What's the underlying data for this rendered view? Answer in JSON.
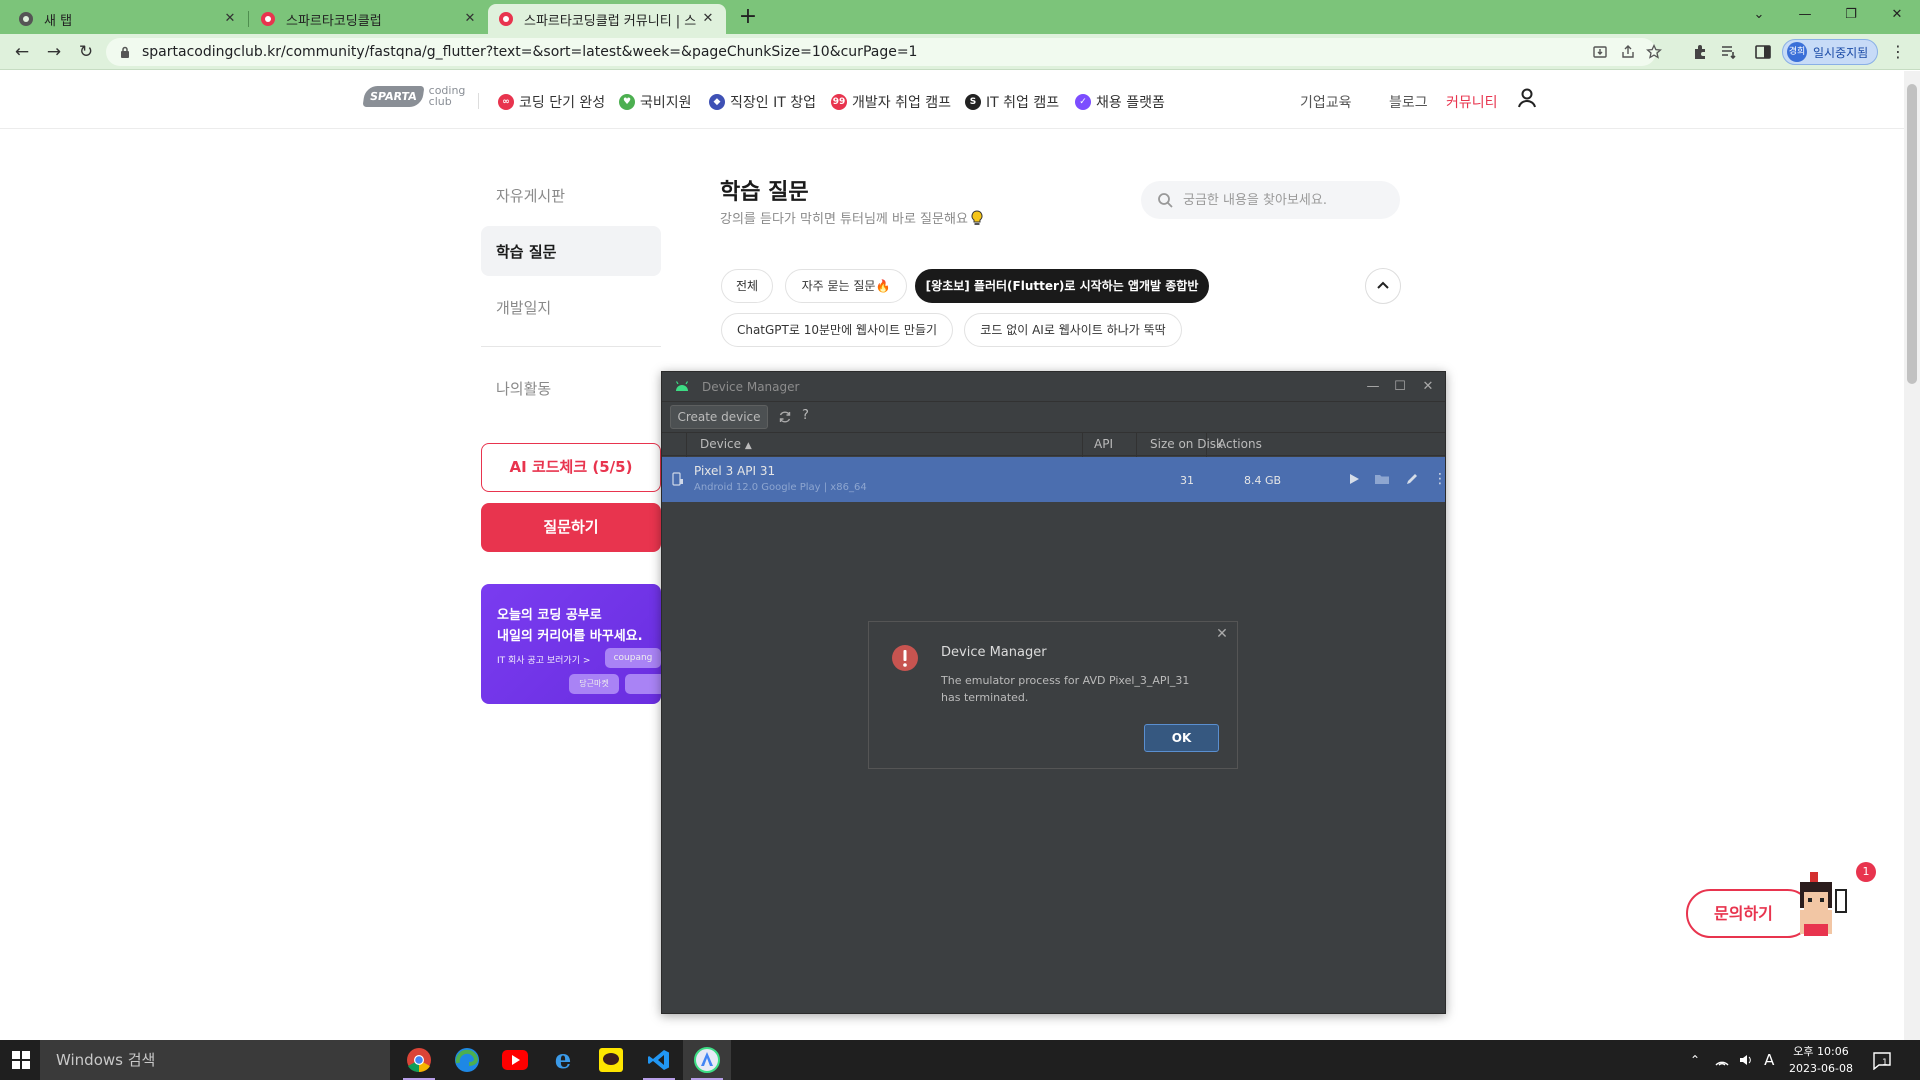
{
  "browser": {
    "tabs": [
      {
        "title": "새 탭",
        "active": false
      },
      {
        "title": "스파르타코딩클럽",
        "active": false
      },
      {
        "title": "스파르타코딩클럽 커뮤니티 | 스",
        "active": true
      }
    ],
    "url": "spartacodingclub.kr/community/fastqna/g_flutter?text=&sort=latest&week=&pageChunkSize=10&curPage=1",
    "profile_label": "일시중지됨",
    "profile_avatar": "경희"
  },
  "site": {
    "logo_badge": "SPARTA",
    "logo_coding": "coding",
    "logo_club": "club",
    "nav": [
      {
        "label": "코딩 단기 완성",
        "color": "#e8344e",
        "icon": "∞"
      },
      {
        "label": "국비지원",
        "color": "#4caf50",
        "icon": "♥"
      },
      {
        "label": "직장인 IT 창업",
        "color": "#3f51b5",
        "icon": "◆"
      },
      {
        "label": "개발자 취업 캠프",
        "color": "#e8344e",
        "icon": "99"
      },
      {
        "label": "IT 취업 캠프",
        "color": "#222222",
        "icon": "S"
      },
      {
        "label": "채용 플랫폼",
        "color": "#7c4dff",
        "icon": "✓"
      }
    ],
    "nav_right": [
      "기업교육",
      "블로그",
      "커뮤니티"
    ],
    "nav_active_color": "#e8344e"
  },
  "sidebar": {
    "items": [
      "자유게시판",
      "학습 질문",
      "개발일지"
    ],
    "my_activity": "나의활동",
    "ai_check": "AI 코드체크 (5/5)",
    "ask": "질문하기",
    "banner": {
      "line1": "오늘의 코딩 공부로",
      "line2": "내일의 커리어를 바꾸세요.",
      "line3": "IT 회사 공고 보러가기  >",
      "chip1": "coupang",
      "chip2": "당근마켓"
    }
  },
  "main": {
    "title": "학습 질문",
    "subtitle": "강의를 듣다가 막히면 튜터님께 바로 질문해요",
    "search_placeholder": "궁금한 내용을 찾아보세요.",
    "filters": [
      "전체",
      "자주 묻는 질문",
      "[왕초보] 플러터(Flutter)로 시작하는 앱개발 종합반",
      "ChatGPT로 10분만에 웹사이트 만들기",
      "코드 없이 AI로 웹사이트 하나가 뚝딱"
    ]
  },
  "device_manager": {
    "title": "Device Manager",
    "create_device": "Create device",
    "columns": [
      "Device",
      "API",
      "Size on Disk",
      "Actions"
    ],
    "devices": [
      {
        "name": "Pixel 3 API 31",
        "subtitle": "Android 12.0 Google Play | x86_64",
        "api": "31",
        "size": "8.4 GB"
      }
    ]
  },
  "dialog": {
    "title": "Device Manager",
    "message": "The emulator process for AVD Pixel_3_API_31 has terminated.",
    "ok": "OK"
  },
  "floating": {
    "contact": "문의하기",
    "badge": "1"
  },
  "taskbar": {
    "search_placeholder": "Windows 검색",
    "ime": "A",
    "time": "오후 10:06",
    "date": "2023-06-08",
    "notifications": "1"
  }
}
